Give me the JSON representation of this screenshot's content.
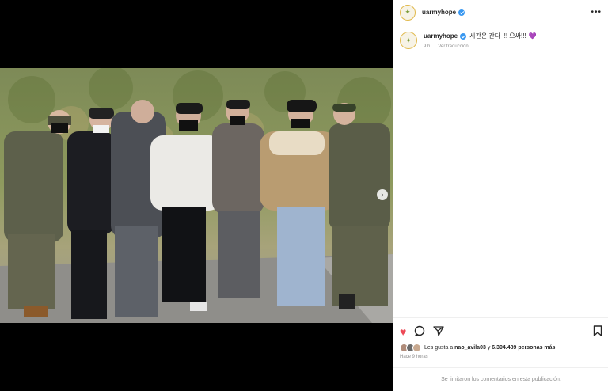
{
  "post": {
    "username": "uarmyhope",
    "caption_text": "시간은 간다 !!! 으싸!!!",
    "caption_emoji": "💜",
    "time_ago": "9 h",
    "see_translation": "Ver traducción",
    "more_icon": "more-horizontal-icon"
  },
  "actions": {
    "like_icon": "heart-filled-icon",
    "comment_icon": "comment-icon",
    "share_icon": "share-icon",
    "save_icon": "bookmark-icon",
    "like_color": "#ed4956"
  },
  "likes": {
    "prefix": "Les gusta a",
    "liked_by": "nao_avila03",
    "connector": "y",
    "count": "6.394.489 personas más"
  },
  "posted": "Hace 9 horas",
  "comments_notice": "Se limitaron los comentarios en esta publicación.",
  "media": {
    "next_icon": "chevron-right-icon"
  }
}
